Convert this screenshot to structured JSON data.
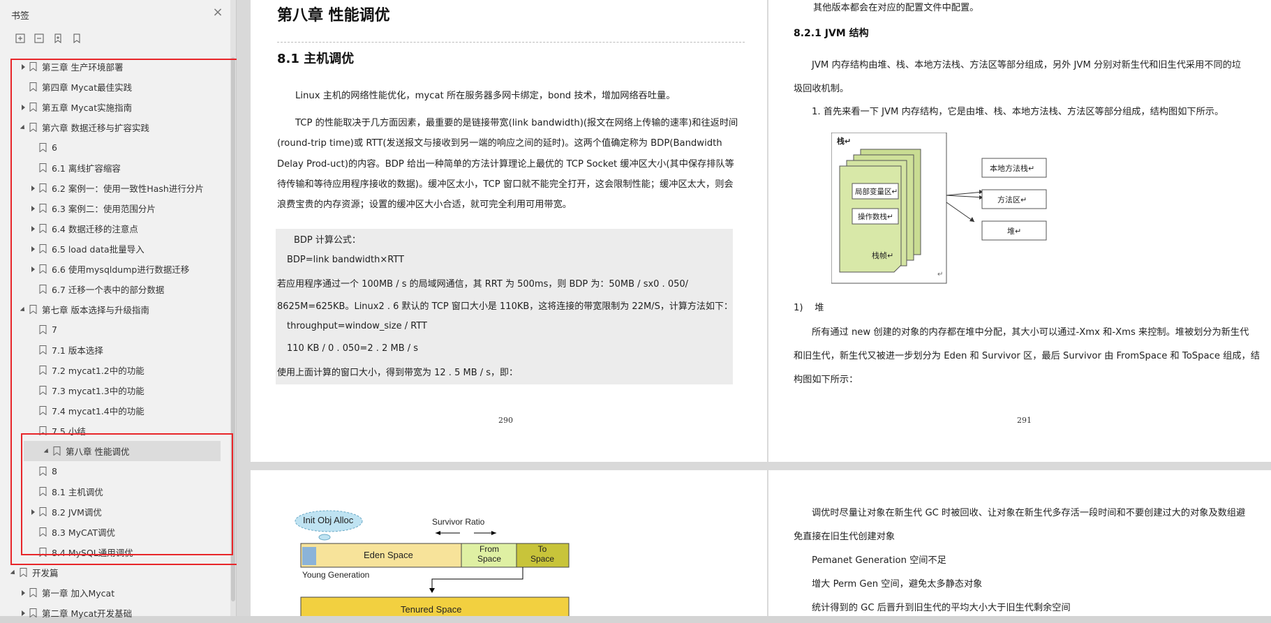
{
  "sidebar": {
    "title": "书签",
    "close_label": "×",
    "tools": [
      "expand-all-icon",
      "collapse-all-icon",
      "add-bookmark-icon",
      "bookmark-outline-icon"
    ],
    "items": [
      {
        "label": "第三章 生产环境部署",
        "level": 1,
        "arrow": "right"
      },
      {
        "label": "第四章 Mycat最佳实践",
        "level": 1,
        "arrow": "none"
      },
      {
        "label": "第五章 Mycat实施指南",
        "level": 1,
        "arrow": "right"
      },
      {
        "label": "第六章 数据迁移与扩容实践",
        "level": 1,
        "arrow": "down"
      },
      {
        "label": "6",
        "level": 2,
        "arrow": "none"
      },
      {
        "label": "6.1 离线扩容缩容",
        "level": 2,
        "arrow": "none"
      },
      {
        "label": "6.2 案例一：使用一致性Hash进行分片",
        "level": 2,
        "arrow": "right"
      },
      {
        "label": "6.3 案例二：使用范围分片",
        "level": 2,
        "arrow": "right"
      },
      {
        "label": "6.4 数据迁移的注意点",
        "level": 2,
        "arrow": "right"
      },
      {
        "label": "6.5 load data批量导入",
        "level": 2,
        "arrow": "right"
      },
      {
        "label": "6.6 使用mysqldump进行数据迁移",
        "level": 2,
        "arrow": "right"
      },
      {
        "label": "6.7 迁移一个表中的部分数据",
        "level": 2,
        "arrow": "none"
      },
      {
        "label": "第七章 版本选择与升级指南",
        "level": 1,
        "arrow": "down"
      },
      {
        "label": "7",
        "level": 2,
        "arrow": "none"
      },
      {
        "label": "7.1 版本选择",
        "level": 2,
        "arrow": "none"
      },
      {
        "label": "7.2 mycat1.2中的功能",
        "level": 2,
        "arrow": "none"
      },
      {
        "label": "7.3 mycat1.3中的功能",
        "level": 2,
        "arrow": "none"
      },
      {
        "label": "7.4 mycat1.4中的功能",
        "level": 2,
        "arrow": "none"
      },
      {
        "label": "7.5 小结",
        "level": 2,
        "arrow": "none"
      },
      {
        "label": "第八章 性能调优",
        "level": 1,
        "arrow": "down",
        "selected": true
      },
      {
        "label": "8",
        "level": 2,
        "arrow": "none"
      },
      {
        "label": "8.1 主机调优",
        "level": 2,
        "arrow": "none"
      },
      {
        "label": "8.2 JVM调优",
        "level": 2,
        "arrow": "right"
      },
      {
        "label": "8.3 MyCAT调优",
        "level": 2,
        "arrow": "none"
      },
      {
        "label": "8.4 MySQL通用调优",
        "level": 2,
        "arrow": "none"
      },
      {
        "label": "开发篇",
        "level": 0,
        "arrow": "down"
      },
      {
        "label": "第一章 加入Mycat",
        "level": 1,
        "arrow": "right"
      },
      {
        "label": "第二章 Mycat开发基础",
        "level": 1,
        "arrow": "right"
      }
    ]
  },
  "page290": {
    "chapter_title": "第八章 性能调优",
    "section_title": "8.1 主机调优",
    "para1": "Linux 主机的网络性能优化，mycat 所在服务器多网卡绑定，bond 技术，增加网络吞吐量。",
    "para2_lines": [
      "TCP 的性能取决于几方面因素，最重要的是链接带宽(link bandwidth)(报文在网络上传输的速率)和往返时间",
      "(round-trip time)或 RTT(发送报文与接收到另一端的响应之间的延时)。这两个值确定称为 BDP(Bandwidth",
      "Delay Prod-uct)的内容。BDP 给出一种简单的方法计算理论上最优的 TCP Socket 缓冲区大小(其中保存排队等",
      "待传输和等待应用程序接收的数据)。缓冲区太小，TCP 窗口就不能完全打开，这会限制性能；缓冲区太大，则会",
      "浪费宝贵的内存资源；设置的缓冲区大小合适，就可完全利用可用带宽。"
    ],
    "code_lines": [
      "BDP 计算公式：",
      "BDP=link bandwidth×RTT",
      "若应用程序通过一个 100MB / s 的局域网通信，其 RRT 为 500ms，则 BDP 为：50MB / sx0 . 050/",
      "8625M=625KB。Linux2 . 6 默认的 TCP 窗口大小是 110KB，这将连接的带宽限制为 22M/S，计算方法如下：",
      "throughput=window_size / RTT",
      "110 KB / 0 . 050=2 . 2 MB / s",
      "使用上面计算的窗口大小，得到带宽为 12 . 5 MB / s，即："
    ],
    "page_number": "290"
  },
  "page291": {
    "intro": "其他版本都会在对应的配置文件中配置。",
    "section_title": "8.2.1    JVM 结构",
    "para1_lines": [
      "JVM 内存结构由堆、栈、本地方法栈、方法区等部分组成，另外 JVM 分别对新生代和旧生代采用不同的垃",
      "圾回收机制。"
    ],
    "list1": "1.  首先来看一下 JVM 内存结构，它是由堆、栈、本地方法栈、方法区等部分组成，结构图如下所示。",
    "diagram": {
      "stack": "栈↵",
      "local_vars": "局部变量区↵",
      "operand_stack": "操作数栈↵",
      "frame": "栈帧↵",
      "native_stack": "本地方法栈↵",
      "method_area": "方法区↵",
      "heap": "堆↵",
      "corner": "↵"
    },
    "list2": "1)    堆",
    "para2_lines": [
      "所有通过 new 创建的对象的内存都在堆中分配，其大小可以通过-Xmx 和-Xms 来控制。堆被划分为新生代",
      "和旧生代，新生代又被进一步划分为 Eden 和 Survivor 区，最后 Survivor 由 FromSpace 和 ToSpace 组成，结",
      "构图如下所示："
    ],
    "page_number": "291"
  },
  "page292": {
    "init_obj": "Init Obj Alloc",
    "survivor_ratio": "Survivor Ratio",
    "eden": "Eden Space",
    "from1": "From",
    "from2": "Space",
    "to1": "To",
    "to2": "Space",
    "young": "Young Generation",
    "tenured": "Tenured Space"
  },
  "page293": {
    "lines": [
      "调优时尽量让对象在新生代 GC 时被回收、让对象在新生代多存活一段时间和不要创建过大的对象及数组避",
      "免直接在旧生代创建对象",
      "Pemanet Generation 空间不足",
      "增大 Perm Gen 空间，避免太多静态对象",
      "统计得到的 GC 后晋升到旧生代的平均大小大于旧生代剩余空间"
    ]
  },
  "colors": {
    "highlight": "#e8262a",
    "code_bg": "#ececec",
    "diagram_green": "#d8e8a8"
  }
}
